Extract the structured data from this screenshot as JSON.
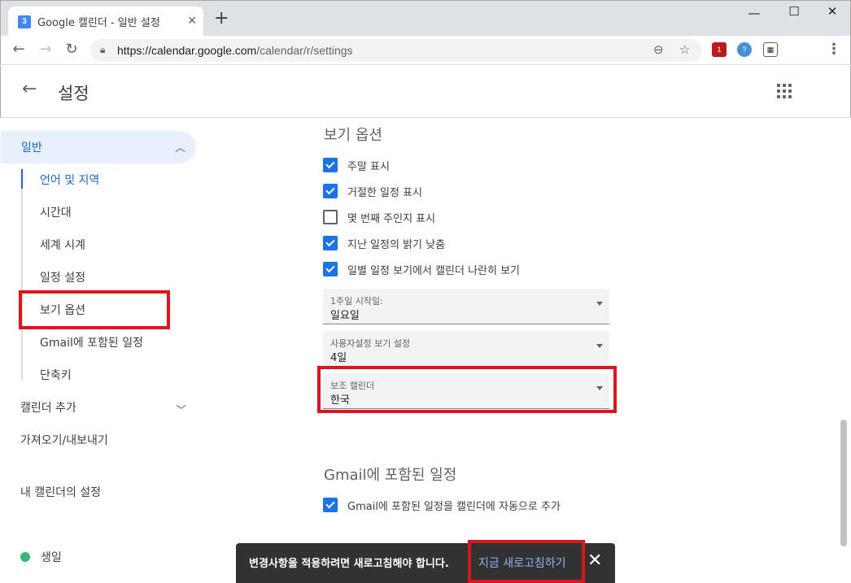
{
  "browser": {
    "tab_favicon_text": "3",
    "tab_title": "Google 캘린더 - 일반 설정",
    "tab_close": "✕",
    "new_tab": "+",
    "url_host": "https://calendar.google.com",
    "url_path": "/calendar/r/settings",
    "extension_badge_1": "1",
    "extension_badge_2": "?"
  },
  "header": {
    "title": "설정"
  },
  "sidebar": {
    "general": "일반",
    "sub_items": [
      "언어 및 지역",
      "시간대",
      "세계 시계",
      "일정 설정",
      "보기 옵션",
      "Gmail에 포함된 일정",
      "단축키"
    ],
    "add_calendar": "캘린더 추가",
    "import_export": "가져오기/내보내기",
    "my_calendars": "내 캘린더의 설정",
    "birthday": "생일"
  },
  "main": {
    "view_options_title": "보기 옵션",
    "checkboxes": [
      {
        "label": "주말 표시",
        "checked": true
      },
      {
        "label": "거절한 일정 표시",
        "checked": true
      },
      {
        "label": "몇 번째 주인지 표시",
        "checked": false
      },
      {
        "label": "지난 일정의 밝기 낮춤",
        "checked": true
      },
      {
        "label": "일별 일정 보기에서 캘린더 나란히 보기",
        "checked": true
      }
    ],
    "selects": [
      {
        "label": "1주일 시작일:",
        "value": "일요일"
      },
      {
        "label": "사용자설정 보기 설정",
        "value": "4일"
      },
      {
        "label": "보조 캘린더",
        "value": "한국"
      }
    ],
    "gmail_title": "Gmail에 포함된 일정",
    "gmail_checkbox": {
      "label": "Gmail에 포함된 일정을 캘린더에 자동으로 추가",
      "checked": true
    }
  },
  "snackbar": {
    "message": "변경사항을 적용하려면 새로고침해야 합니다.",
    "action": "지금 새로고침하기",
    "close": "✕"
  },
  "colors": {
    "accent": "#1a73e8",
    "highlight": "#e0151c",
    "birthday": "#33b679"
  }
}
